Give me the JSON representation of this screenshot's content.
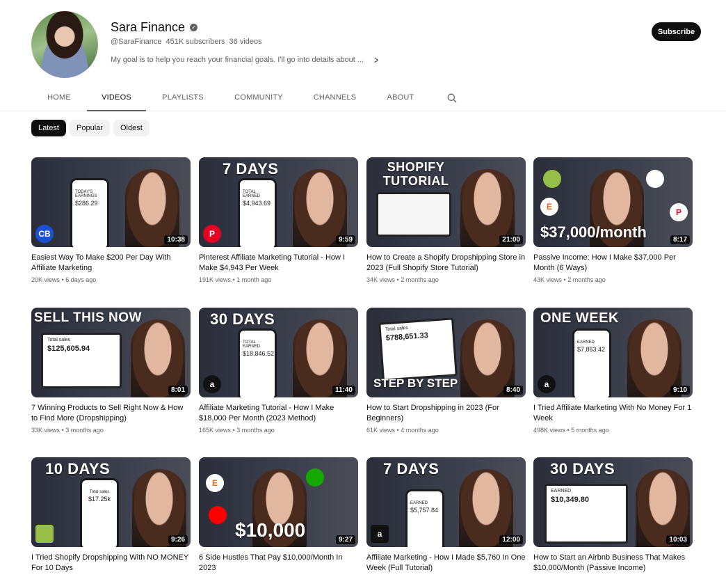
{
  "channel": {
    "name": "Sara Finance",
    "handle": "@SaraFinance",
    "subscribers": "451K subscribers",
    "video_count": "36 videos",
    "description": "My goal is to help you reach your financial goals. I'll go into details about ...",
    "subscribe_label": "Subscribe"
  },
  "tabs": [
    "HOME",
    "VIDEOS",
    "PLAYLISTS",
    "COMMUNITY",
    "CHANNELS",
    "ABOUT"
  ],
  "active_tab": "VIDEOS",
  "chips": [
    "Latest",
    "Popular",
    "Oldest"
  ],
  "active_chip": "Latest",
  "videos": [
    {
      "title": "Easiest Way To Make $200 Per Day With Affiliate Marketing",
      "views": "20K views",
      "age": "6 days ago",
      "duration": "10:38",
      "thumb_text": "",
      "thumb_label": "TODAY'S EARNINGS",
      "thumb_value": "$286.29",
      "logo": "CB"
    },
    {
      "title": "Pinterest Affiliate Marketing Tutorial - How I Make $4,943 Per Week",
      "views": "191K views",
      "age": "1 month ago",
      "duration": "9:59",
      "thumb_text": "7 DAYS",
      "thumb_label": "TOTAL EARNED",
      "thumb_value": "$4,943.69",
      "logo": "P"
    },
    {
      "title": "How to Create a Shopify Dropshipping Store in 2023 (Full Shopify Store Tutorial)",
      "views": "34K views",
      "age": "2 months ago",
      "duration": "21:00",
      "thumb_text": "SHOPIFY TUTORIAL",
      "thumb_label": "",
      "thumb_value": "",
      "logo": ""
    },
    {
      "title": "Passive Income: How I Make $37,000 Per Month (6 Ways)",
      "views": "43K views",
      "age": "2 months ago",
      "duration": "8:17",
      "thumb_text": "$37,000/month",
      "thumb_label": "",
      "thumb_value": "",
      "logo": ""
    },
    {
      "title": "7 Winning Products to Sell Right Now & How to Find More (Dropshipping)",
      "views": "33K views",
      "age": "3 months ago",
      "duration": "8:01",
      "thumb_text": "SELL THIS NOW",
      "thumb_label": "Total sales",
      "thumb_value": "$125,605.94",
      "logo": ""
    },
    {
      "title": "Affiliate Marketing Tutorial - How I Make $18,000 Per Month (2023 Method)",
      "views": "165K views",
      "age": "3 months ago",
      "duration": "11:40",
      "thumb_text": "30 DAYS",
      "thumb_label": "TOTAL EARNED",
      "thumb_value": "$18,846.52",
      "logo": "a"
    },
    {
      "title": "How to Start Dropshipping in 2023 (For Beginners)",
      "views": "61K views",
      "age": "4 months ago",
      "duration": "8:40",
      "thumb_text": "STEP BY STEP",
      "thumb_label": "Total sales",
      "thumb_value": "$788,651.33",
      "logo": ""
    },
    {
      "title": "I Tried Affiliate Marketing With No Money For 1 Week",
      "views": "498K views",
      "age": "5 months ago",
      "duration": "9:10",
      "thumb_text": "ONE WEEK",
      "thumb_label": "EARNED",
      "thumb_value": "$7,863.42",
      "logo": "a"
    },
    {
      "title": "I Tried Shopify Dropshipping With NO MONEY For 10 Days",
      "views": "",
      "age": "",
      "duration": "9:26",
      "thumb_text": "10 DAYS",
      "thumb_label": "Total sales",
      "thumb_value": "$17.25k",
      "logo": ""
    },
    {
      "title": "6 Side Hustles That Pay $10,000/Month In 2023",
      "views": "",
      "age": "",
      "duration": "9:27",
      "thumb_text": "$10,000",
      "thumb_label": "",
      "thumb_value": "",
      "logo": ""
    },
    {
      "title": "Affiliate Marketing - How I Made $5,760 In One Week (Full Tutorial)",
      "views": "",
      "age": "",
      "duration": "12:00",
      "thumb_text": "7 DAYS",
      "thumb_label": "EARNED",
      "thumb_value": "$5,757.84",
      "logo": "a"
    },
    {
      "title": "How to Start an Airbnb Business That Makes $10,000/Month (Passive Income)",
      "views": "",
      "age": "",
      "duration": "10:03",
      "thumb_text": "30 DAYS",
      "thumb_label": "EARNED",
      "thumb_value": "$10,349.80",
      "logo": ""
    }
  ]
}
